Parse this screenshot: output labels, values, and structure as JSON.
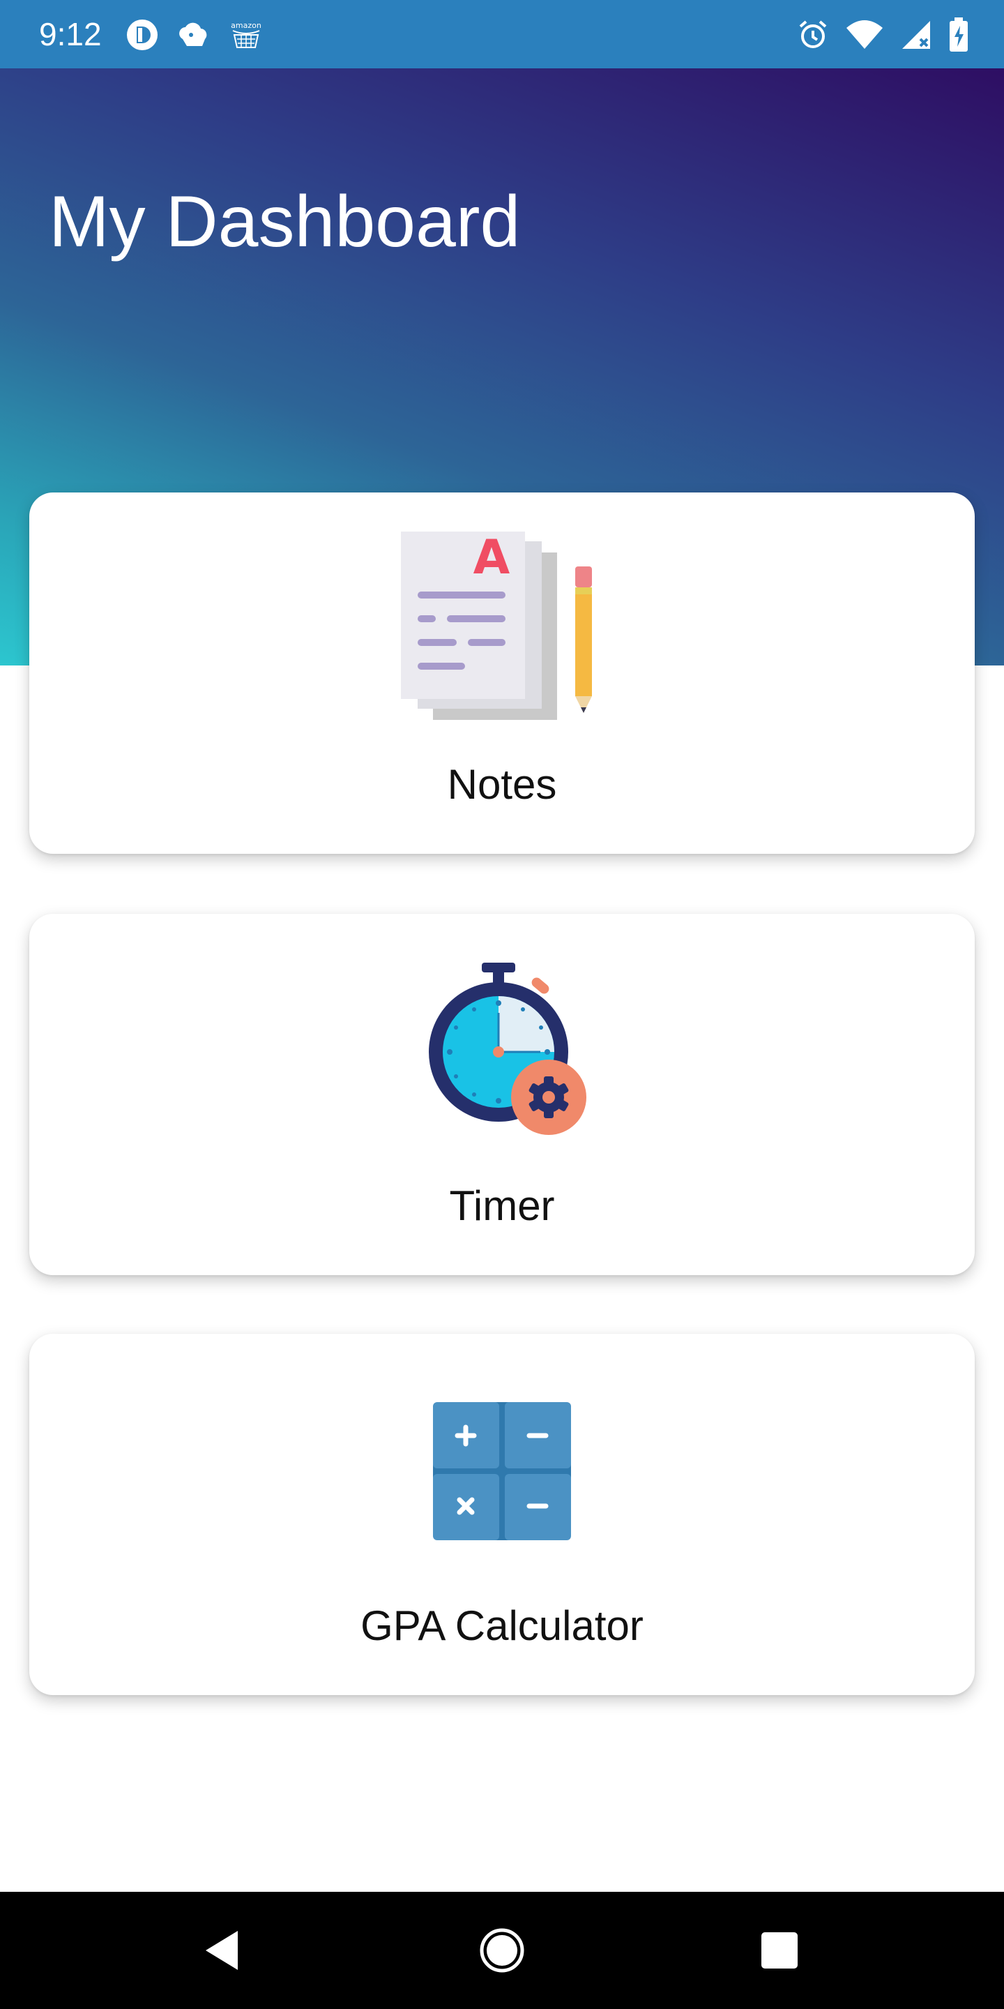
{
  "status_bar": {
    "time": "9:12",
    "left_icons": [
      "app-notification-icon",
      "cloud-notification-icon",
      "amazon-notification-icon"
    ],
    "right_icons": [
      "alarm-icon",
      "wifi-icon",
      "signal-icon",
      "battery-charging-icon"
    ]
  },
  "header": {
    "title": "My Dashboard",
    "gradient_colors": [
      "#2e0e63",
      "#2d6597",
      "#2cc6cf"
    ]
  },
  "cards": [
    {
      "label": "Notes",
      "icon": "notes-icon"
    },
    {
      "label": "Timer",
      "icon": "stopwatch-icon"
    },
    {
      "label": "GPA Calculator",
      "icon": "calculator-icon"
    }
  ],
  "nav_bar": {
    "buttons": [
      "back-icon",
      "home-icon",
      "recents-icon"
    ]
  },
  "colors": {
    "status_bar": "#2b80bd",
    "nav_bar": "#000000",
    "card_background": "#ffffff"
  }
}
